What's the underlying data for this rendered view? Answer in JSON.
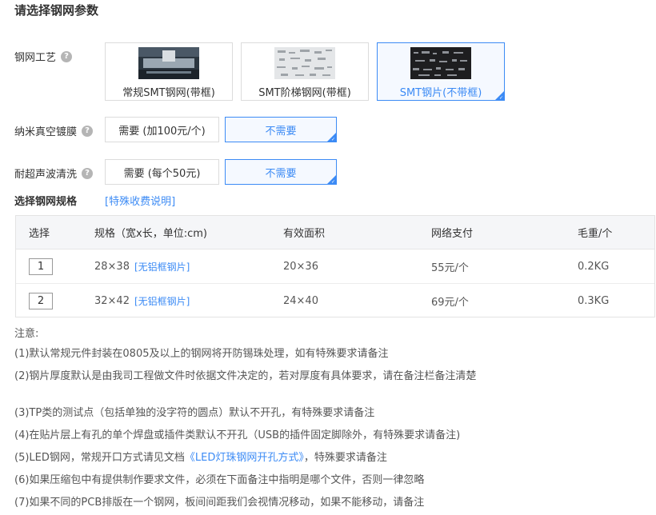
{
  "page_title": "请选择钢网参数",
  "process": {
    "label": "钢网工艺",
    "options": [
      {
        "label": "常规SMT钢网(带框)",
        "selected": false
      },
      {
        "label": "SMT阶梯钢网(带框)",
        "selected": false
      },
      {
        "label": "SMT钢片(不带框)",
        "selected": true
      }
    ]
  },
  "nano_coating": {
    "label": "纳米真空镀膜",
    "options": [
      {
        "label": "需要 (加100元/个)",
        "selected": false
      },
      {
        "label": "不需要",
        "selected": true
      }
    ]
  },
  "ultrasonic": {
    "label": "耐超声波清洗",
    "options": [
      {
        "label": "需要 (每个50元)",
        "selected": false
      },
      {
        "label": "不需要",
        "selected": true
      }
    ]
  },
  "spec": {
    "title": "选择钢网规格",
    "fee_link": "[特殊收费说明]",
    "columns": [
      "选择",
      "规格（宽x长，单位:cm)",
      "有效面积",
      "网络支付",
      "毛重/个"
    ],
    "rows": [
      {
        "qty": "1",
        "size": "28×38",
        "tag": "[无铝框钢片]",
        "area": "20×36",
        "price": "55元/个",
        "weight": "0.2KG"
      },
      {
        "qty": "2",
        "size": "32×42",
        "tag": "[无铝框钢片]",
        "area": "24×40",
        "price": "69元/个",
        "weight": "0.3KG"
      }
    ]
  },
  "notes": {
    "title": "注意:",
    "items": [
      "(1)默认常规元件封装在0805及以上的钢网将开防锡珠处理，如有特殊要求请备注",
      "(2)钢片厚度默认是由我司工程做文件时依据文件决定的，若对厚度有具体要求，请在备注栏备注清楚",
      "(3)TP类的测试点（包括单独的没字符的圆点）默认不开孔，有特殊要求请备注",
      "(4)在贴片层上有孔的单个焊盘或插件类默认不开孔（USB的插件固定脚除外，有特殊要求请备注)",
      "(6)如果压缩包中有提供制作要求文件，必须在下面备注中指明是哪个文件，否则一律忽略",
      "(7)如果不同的PCB排版在一个钢网，板间间距我们会视情况移动，如果不能移动，请备注"
    ],
    "led": {
      "prefix": "(5)LED钢网，常规开口方式请见文档",
      "link": "《LED灯珠钢网开孔方式》",
      "suffix": "，特殊要求请备注"
    }
  },
  "colors": {
    "accent": "#3c8bf5",
    "help_icon": "#b5b5b5"
  }
}
